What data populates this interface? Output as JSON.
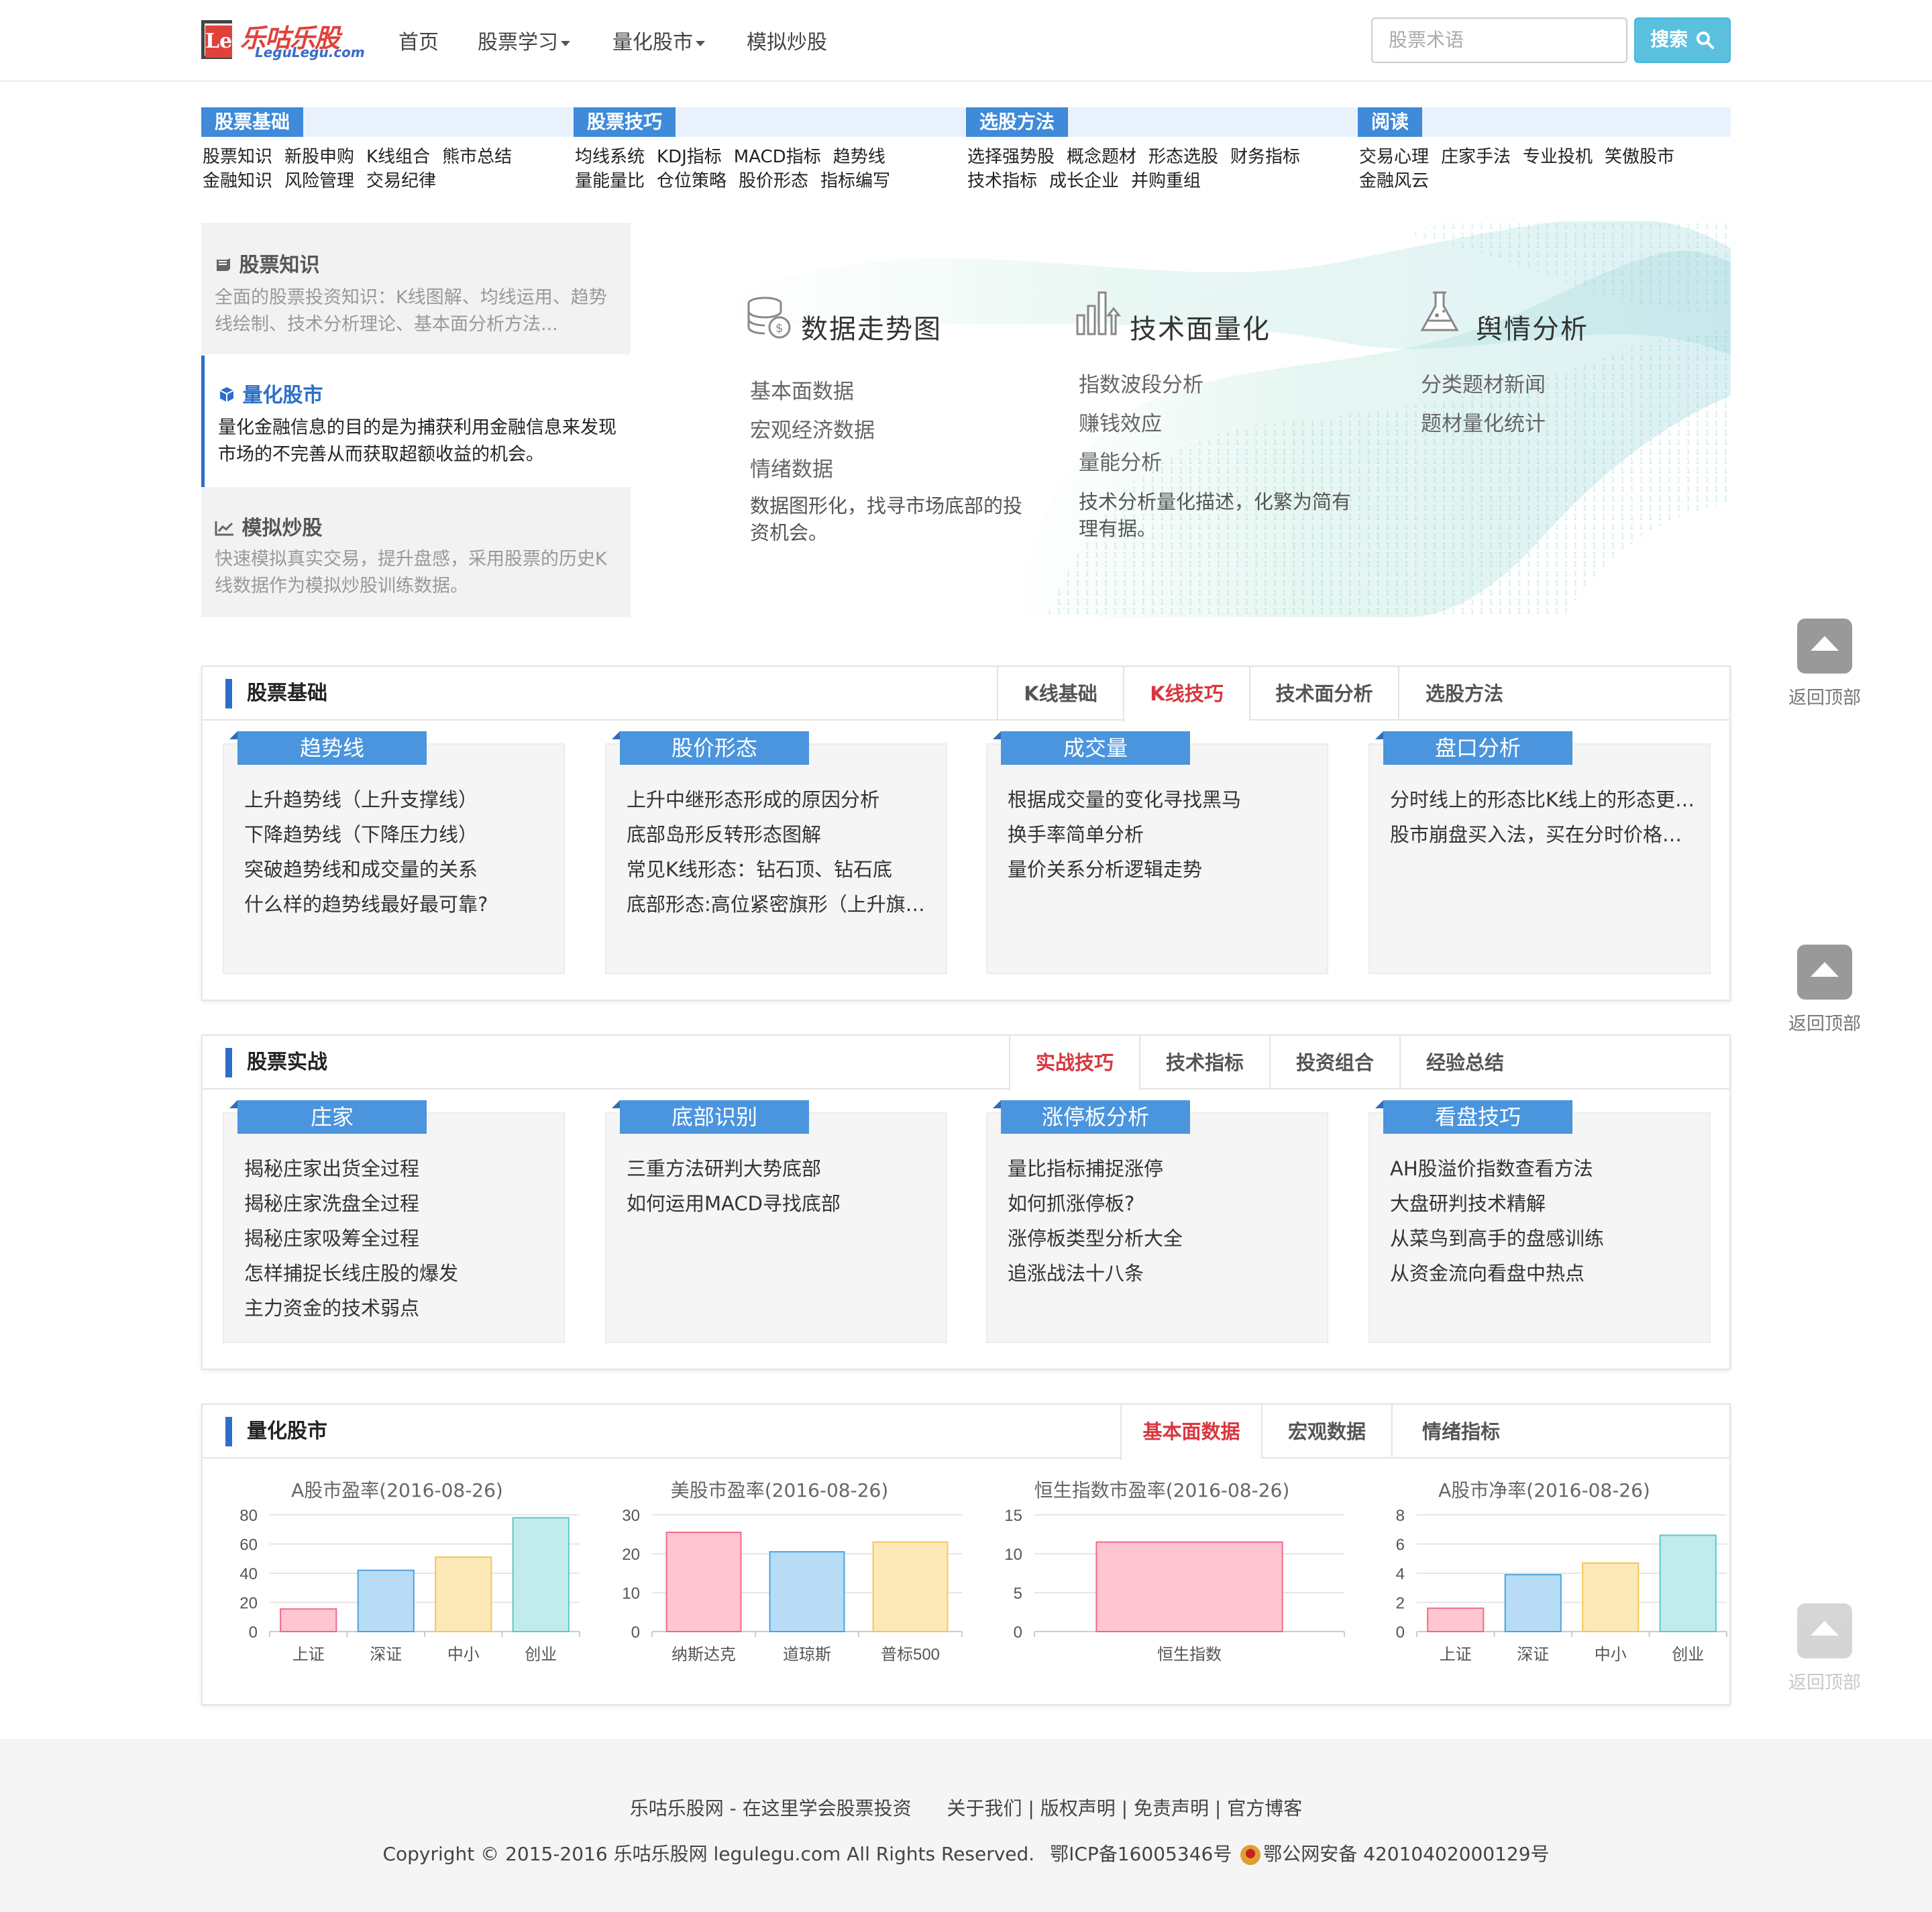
{
  "header": {
    "logo_cn": "乐咕乐股",
    "logo_en": "LeguLegu.com",
    "logo_mark": "Le",
    "nav": [
      {
        "label": "首页",
        "dropdown": false
      },
      {
        "label": "股票学习",
        "dropdown": true
      },
      {
        "label": "量化股市",
        "dropdown": true
      },
      {
        "label": "模拟炒股",
        "dropdown": false
      }
    ],
    "search_placeholder": "股票术语",
    "search_button": "搜索"
  },
  "categories": [
    {
      "tag": "股票基础",
      "rows": [
        [
          "股票知识",
          "新股申购",
          "K线组合",
          "熊市总结"
        ],
        [
          "金融知识",
          "风险管理",
          "交易纪律"
        ]
      ]
    },
    {
      "tag": "股票技巧",
      "rows": [
        [
          "均线系统",
          "KDJ指标",
          "MACD指标",
          "趋势线"
        ],
        [
          "量能量比",
          "仓位策略",
          "股价形态",
          "指标编写"
        ]
      ]
    },
    {
      "tag": "选股方法",
      "rows": [
        [
          "选择强势股",
          "概念题材",
          "形态选股",
          "财务指标"
        ],
        [
          "技术指标",
          "成长企业",
          "并购重组"
        ]
      ]
    },
    {
      "tag": "阅读",
      "rows": [
        [
          "交易心理",
          "庄家手法",
          "专业投机",
          "笑傲股市"
        ],
        [
          "金融风云"
        ]
      ]
    }
  ],
  "features": [
    {
      "title": "股票知识",
      "desc": "全面的股票投资知识：K线图解、均线运用、趋势线绘制、技术分析理论、基本面分析方法...",
      "active": false
    },
    {
      "title": "量化股市",
      "desc": "量化金融信息的目的是为捕获利用金融信息来发现市场的不完善从而获取超额收益的机会。",
      "active": true
    },
    {
      "title": "模拟炒股",
      "desc": "快速模拟真实交易，提升盘感，采用股票的历史K线数据作为模拟炒股训练数据。",
      "active": false
    }
  ],
  "hero": [
    {
      "title": "数据走势图",
      "icon": "coins-icon",
      "items": [
        "基本面数据",
        "宏观经济数据",
        "情绪数据"
      ],
      "note": "数据图形化，找寻市场底部的投资机会。"
    },
    {
      "title": "技术面量化",
      "icon": "bar-chart-icon",
      "items": [
        "指数波段分析",
        "赚钱效应",
        "量能分析"
      ],
      "note": "技术分析量化描述，化繁为简有理有据。"
    },
    {
      "title": "舆情分析",
      "icon": "flask-icon",
      "items": [
        "分类题材新闻",
        "题材量化统计"
      ],
      "note": ""
    }
  ],
  "sections": [
    {
      "title": "股票基础",
      "tabs": [
        {
          "label": "K线基础",
          "active": false
        },
        {
          "label": "K线技巧",
          "active": true
        },
        {
          "label": "技术面分析",
          "active": false
        },
        {
          "label": "选股方法",
          "active": false
        }
      ],
      "cards": [
        {
          "tag": "趋势线",
          "items": [
            "上升趋势线（上升支撑线）",
            "下降趋势线（下降压力线）",
            "突破趋势线和成交量的关系",
            "什么样的趋势线最好最可靠?"
          ]
        },
        {
          "tag": "股价形态",
          "items": [
            "上升中继形态形成的原因分析",
            "底部岛形反转形态图解",
            "常见K线形态：钻石顶、钻石底",
            "底部形态:高位紧密旗形（上升旗…"
          ]
        },
        {
          "tag": "成交量",
          "items": [
            "根据成交量的变化寻找黑马",
            "换手率简单分析",
            "量价关系分析逻辑走势"
          ]
        },
        {
          "tag": "盘口分析",
          "items": [
            "分时线上的形态比K线上的形态更…",
            "股市崩盘买入法，买在分时价格…"
          ]
        }
      ]
    },
    {
      "title": "股票实战",
      "tabs": [
        {
          "label": "实战技巧",
          "active": true
        },
        {
          "label": "技术指标",
          "active": false
        },
        {
          "label": "投资组合",
          "active": false
        },
        {
          "label": "经验总结",
          "active": false
        }
      ],
      "cards": [
        {
          "tag": "庄家",
          "items": [
            "揭秘庄家出货全过程",
            "揭秘庄家洗盘全过程",
            "揭秘庄家吸筹全过程",
            "怎样捕捉长线庄股的爆发",
            "主力资金的技术弱点"
          ]
        },
        {
          "tag": "底部识别",
          "items": [
            "三重方法研判大势底部",
            "如何运用MACD寻找底部"
          ]
        },
        {
          "tag": "涨停板分析",
          "items": [
            "量比指标捕捉涨停",
            "如何抓涨停板?",
            "涨停板类型分析大全",
            "追涨战法十八条"
          ]
        },
        {
          "tag": "看盘技巧",
          "items": [
            "AH股溢价指数查看方法",
            "大盘研判技术精解",
            "从菜鸟到高手的盘感训练",
            "从资金流向看盘中热点"
          ]
        }
      ]
    },
    {
      "title": "量化股市",
      "tabs": [
        {
          "label": "基本面数据",
          "active": true
        },
        {
          "label": "宏观数据",
          "active": false
        },
        {
          "label": "情绪指标",
          "active": false
        }
      ]
    }
  ],
  "chart_data": [
    {
      "type": "bar",
      "title": "A股市盈率(2016-08-26)",
      "categories": [
        "上证",
        "深证",
        "中小",
        "创业"
      ],
      "values": [
        15.5,
        42,
        51,
        78
      ],
      "ylim": [
        0,
        80
      ],
      "yticks": [
        0,
        20,
        40,
        60,
        80
      ],
      "colors": [
        "#ffc5d1",
        "#b8dcf5",
        "#fde9b8",
        "#c2ecec"
      ],
      "strokes": [
        "#f06a8a",
        "#4ba3e0",
        "#f3c75a",
        "#5cc8c8"
      ]
    },
    {
      "type": "bar",
      "title": "美股市盈率(2016-08-26)",
      "categories": [
        "纳斯达克",
        "道琼斯",
        "普标500"
      ],
      "values": [
        25.5,
        20.5,
        23
      ],
      "ylim": [
        0,
        30
      ],
      "yticks": [
        0,
        10,
        20,
        30
      ],
      "colors": [
        "#ffc5d1",
        "#b8dcf5",
        "#fde9b8"
      ],
      "strokes": [
        "#f06a8a",
        "#4ba3e0",
        "#f3c75a"
      ]
    },
    {
      "type": "bar",
      "title": "恒生指数市盈率(2016-08-26)",
      "categories": [
        "恒生指数"
      ],
      "values": [
        11.5
      ],
      "ylim": [
        0,
        15
      ],
      "yticks": [
        0,
        5,
        10,
        15
      ],
      "colors": [
        "#ffc5d1"
      ],
      "strokes": [
        "#f06a8a"
      ]
    },
    {
      "type": "bar",
      "title": "A股市净率(2016-08-26)",
      "categories": [
        "上证",
        "深证",
        "中小",
        "创业"
      ],
      "values": [
        1.6,
        3.9,
        4.7,
        6.6
      ],
      "ylim": [
        0,
        8
      ],
      "yticks": [
        0,
        2,
        4,
        6,
        8
      ],
      "colors": [
        "#ffc5d1",
        "#b8dcf5",
        "#fde9b8",
        "#c2ecec"
      ],
      "strokes": [
        "#f06a8a",
        "#4ba3e0",
        "#f3c75a",
        "#5cc8c8"
      ]
    }
  ],
  "back_to_top": "返回顶部",
  "footer": {
    "site": "乐咕乐股网 - 在这里学会股票投资",
    "links": [
      "关于我们",
      "版权声明",
      "免责声明",
      "官方博客"
    ],
    "copyright": "Copyright © 2015-2016 乐咕乐股网 legulegu.com All Rights Reserved.",
    "icp": "鄂ICP备16005346号",
    "police": "鄂公网安备 42010402000129号"
  }
}
